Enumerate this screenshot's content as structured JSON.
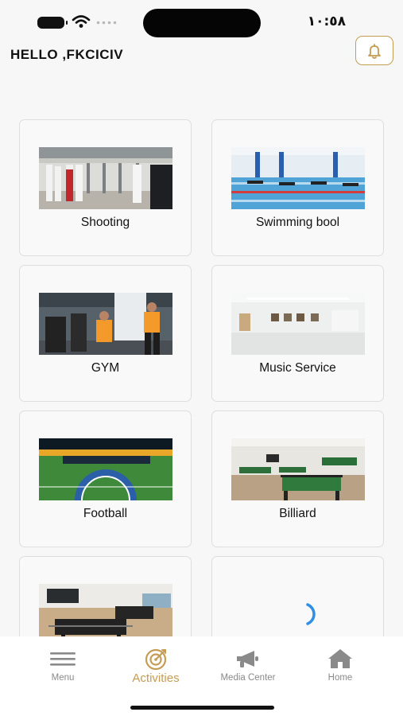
{
  "status_bar": {
    "time": "١٠:٥٨"
  },
  "header": {
    "greeting": "HELLO ,FKCICIV",
    "notification_icon": "bell-icon"
  },
  "activities": [
    {
      "label": "Shooting"
    },
    {
      "label": "Swimming bool"
    },
    {
      "label": "GYM"
    },
    {
      "label": "Music Service"
    },
    {
      "label": "Football"
    },
    {
      "label": "Billiard"
    },
    {
      "label": ""
    },
    {
      "label": ""
    }
  ],
  "bottom_nav": {
    "items": [
      {
        "label": "Menu",
        "icon": "menu-icon"
      },
      {
        "label": "Activities",
        "icon": "target-icon",
        "active": true
      },
      {
        "label": "Media Center",
        "icon": "megaphone-icon"
      },
      {
        "label": "Home",
        "icon": "home-icon"
      }
    ]
  },
  "colors": {
    "accent": "#c59c53",
    "spinner": "#2f8fe6",
    "background": "#f7f7f7"
  }
}
